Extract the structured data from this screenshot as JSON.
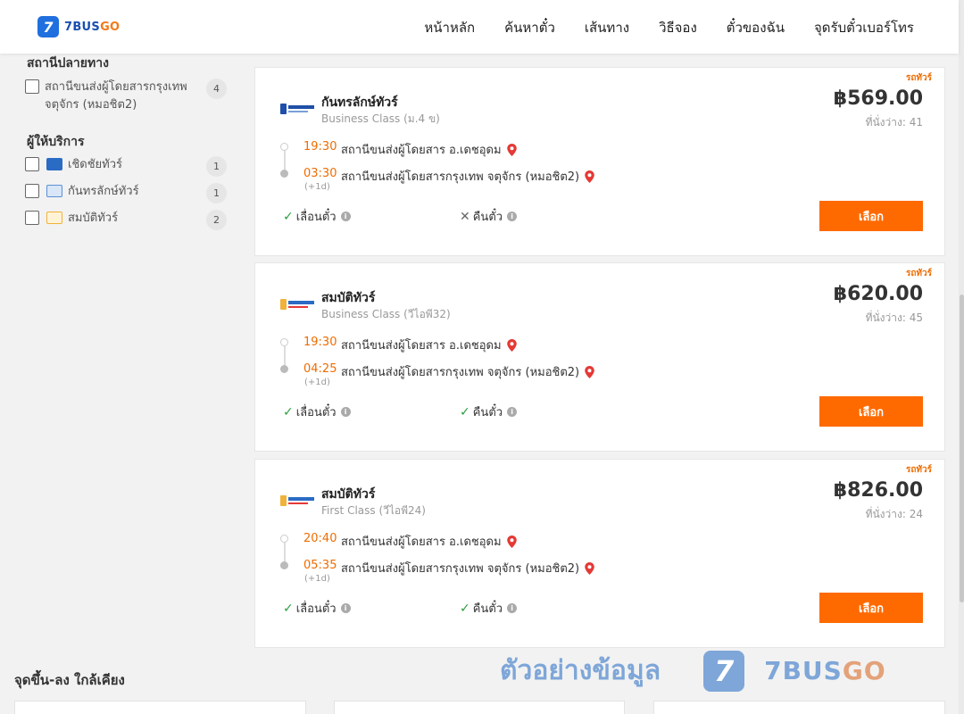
{
  "header": {
    "logo_mark": "7",
    "logo_text_a": "7BUS",
    "logo_text_b": "GO",
    "nav": [
      "หน้าหลัก",
      "ค้นหาตั๋ว",
      "เส้นทาง",
      "วิธีจอง",
      "ตั๋วของฉัน",
      "จุดรับตั๋วเบอร์โทร"
    ]
  },
  "sidebar": {
    "destination_heading": "สถานีปลายทาง",
    "destinations": [
      {
        "label": "สถานีขนส่งผู้โดยสารกรุงเทพ จตุจักร (หมอชิต2)",
        "count": "4"
      }
    ],
    "operators_heading": "ผู้ให้บริการ",
    "operators": [
      {
        "label": "เชิดชัยทัวร์",
        "count": "1",
        "logo_color": "#2a6bc4"
      },
      {
        "label": "กันทรลักษ์ทัวร์",
        "count": "1",
        "logo_color": "#5b8fd6"
      },
      {
        "label": "สมบัติทัวร์",
        "count": "2",
        "logo_color": "#f0b23a"
      }
    ]
  },
  "labels": {
    "tag": "รถทัวร์",
    "seats_prefix": "ที่นั่งว่าง: ",
    "plus_day": "(+1d)",
    "change_ticket": "เลื่อนตั๋ว",
    "refund_ticket": "คืนตั๋ว",
    "select": "เลือก",
    "info_glyph": "i"
  },
  "trips": [
    {
      "operator": "กันทรลักษ์ทัวร์",
      "bus_class": "Business Class (ม.4 ข)",
      "price": "฿569.00",
      "seats": "ที่นั่งว่าง: 41",
      "depart_time": "19:30",
      "depart_stop": "สถานีขนส่งผู้โดยสาร อ.เดชอุดม",
      "arrive_time": "03:30",
      "arrive_stop": "สถานีขนส่งผู้โดยสารกรุงเทพ จตุจักร (หมอชิต2)",
      "change_allowed": true,
      "refund_allowed": false
    },
    {
      "operator": "สมบัติทัวร์",
      "bus_class": "Business Class (วีไอพี32)",
      "price": "฿620.00",
      "seats": "ที่นั่งว่าง: 45",
      "depart_time": "19:30",
      "depart_stop": "สถานีขนส่งผู้โดยสาร อ.เดชอุดม",
      "arrive_time": "04:25",
      "arrive_stop": "สถานีขนส่งผู้โดยสารกรุงเทพ จตุจักร (หมอชิต2)",
      "change_allowed": true,
      "refund_allowed": true
    },
    {
      "operator": "สมบัติทัวร์",
      "bus_class": "First Class (วีไอพี24)",
      "price": "฿826.00",
      "seats": "ที่นั่งว่าง: 24",
      "depart_time": "20:40",
      "depart_stop": "สถานีขนส่งผู้โดยสาร อ.เดชอุดม",
      "arrive_time": "05:35",
      "arrive_stop": "สถานีขนส่งผู้โดยสารกรุงเทพ จตุจักร (หมอชิต2)",
      "change_allowed": true,
      "refund_allowed": true
    }
  ],
  "nearby_heading": "จุดขึ้น-ลง ใกล้เคียง",
  "watermark": {
    "text": "ตัวอย่างข้อมูล",
    "mark": "7",
    "brand_a": "7BUS",
    "brand_b": "GO"
  },
  "colors": {
    "accent": "#ff6a00",
    "brand_blue": "#1f6fde",
    "ok_green": "#2e9e3e"
  }
}
